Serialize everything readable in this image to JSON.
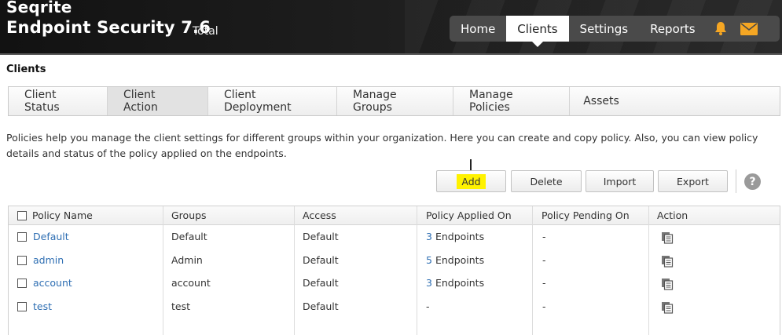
{
  "header": {
    "brand_line1": "Seqrite",
    "brand_line2": "Endpoint Security 7.6",
    "edition": "Total",
    "nav": [
      {
        "label": "Home",
        "active": false
      },
      {
        "label": "Clients",
        "active": true
      },
      {
        "label": "Settings",
        "active": false
      },
      {
        "label": "Reports",
        "active": false
      }
    ],
    "icons": [
      "bell-icon",
      "mail-icon"
    ],
    "accent_bell": "#f5a623",
    "accent_mail": "#f5a623"
  },
  "page_title": "Clients",
  "tabs": [
    {
      "label": "Client Status",
      "active": false
    },
    {
      "label": "Client Action",
      "active": true
    },
    {
      "label": "Client Deployment",
      "active": false
    },
    {
      "label": "Manage Groups",
      "active": false
    },
    {
      "label": "Manage Policies",
      "active": false
    },
    {
      "label": "Assets",
      "active": false
    }
  ],
  "description": "Policies help you manage the client settings for different groups within your organization. Here you can create and copy policy. Also, you can view policy details and status of the policy applied on the endpoints.",
  "actions": {
    "add": "Add",
    "delete": "Delete",
    "import": "Import",
    "export": "Export",
    "help": "?"
  },
  "table": {
    "columns": [
      "Policy Name",
      "Groups",
      "Access",
      "Policy Applied On",
      "Policy Pending On",
      "Action"
    ],
    "rows": [
      {
        "name": "Default",
        "group": "Default",
        "access": "Default",
        "applied_count": "3",
        "applied_label": "Endpoints",
        "pending": "-"
      },
      {
        "name": "admin",
        "group": "Admin",
        "access": "Default",
        "applied_count": "5",
        "applied_label": "Endpoints",
        "pending": "-"
      },
      {
        "name": "account",
        "group": "account",
        "access": "Default",
        "applied_count": "3",
        "applied_label": "Endpoints",
        "pending": "-"
      },
      {
        "name": "test",
        "group": "test",
        "access": "Default",
        "applied_count": "",
        "applied_label": "-",
        "pending": "-"
      }
    ]
  }
}
